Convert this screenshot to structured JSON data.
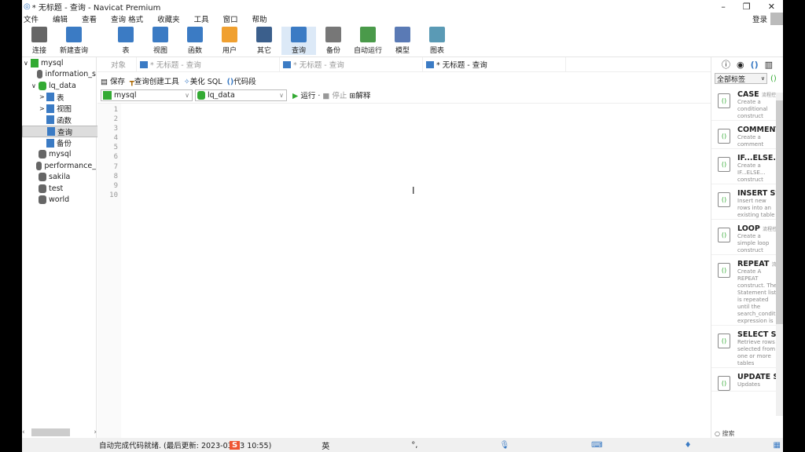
{
  "window": {
    "title": "* 无标题 - 查询 - Navicat Premium",
    "minimize": "–",
    "maximize": "❐",
    "close": "✕"
  },
  "menu": [
    "文件",
    "编辑",
    "查看",
    "查询 格式",
    "收藏夹",
    "工具",
    "窗口",
    "帮助"
  ],
  "login": "登录",
  "toolbar": [
    {
      "label": "连接",
      "color": "#666"
    },
    {
      "label": "新建查询",
      "color": "#3b7bc4"
    },
    {
      "label": "表",
      "color": "#3b7bc4"
    },
    {
      "label": "视图",
      "color": "#3b7bc4"
    },
    {
      "label": "函数",
      "color": "#3b7bc4"
    },
    {
      "label": "用户",
      "color": "#f0a030"
    },
    {
      "label": "其它",
      "color": "#3b5f8c"
    },
    {
      "label": "查询",
      "color": "#3b7bc4"
    },
    {
      "label": "备份",
      "color": "#777"
    },
    {
      "label": "自动运行",
      "color": "#4a9a4a"
    },
    {
      "label": "模型",
      "color": "#5a7ab5"
    },
    {
      "label": "图表",
      "color": "#5a9ab5"
    }
  ],
  "tree": [
    {
      "label": "mysql",
      "level": 0,
      "exp": "∨"
    },
    {
      "label": "information_s",
      "level": 1
    },
    {
      "label": "lq_data",
      "level": 1,
      "exp": "∨"
    },
    {
      "label": "表",
      "level": 2,
      "exp": ">"
    },
    {
      "label": "视图",
      "level": 2,
      "exp": ">"
    },
    {
      "label": "函数",
      "level": 2,
      "prefix": "fx"
    },
    {
      "label": "查询",
      "level": 2,
      "selected": true
    },
    {
      "label": "备份",
      "level": 2
    },
    {
      "label": "mysql",
      "level": 1
    },
    {
      "label": "performance_",
      "level": 1
    },
    {
      "label": "sakila",
      "level": 1
    },
    {
      "label": "test",
      "level": 1
    },
    {
      "label": "world",
      "level": 1
    }
  ],
  "tabs": {
    "objects": "对象",
    "items": [
      "* 无标题 - 查询",
      "* 无标题 - 查询",
      "* 无标题 - 查询"
    ]
  },
  "editor_toolbar": {
    "save": "保存",
    "builder": "查询创建工具",
    "beautify": "美化 SQL",
    "snippet": "代码段",
    "run": "运行 ·",
    "stop": "停止",
    "explain": "解释"
  },
  "connection": "mysql",
  "database": "lq_data",
  "line_numbers": [
    "1",
    "2",
    "3",
    "4",
    "5",
    "6",
    "7",
    "8",
    "9",
    "10"
  ],
  "right_panel": {
    "filter": "全部标签",
    "snippets": [
      {
        "name": "CASE",
        "tag": "流程控",
        "desc": "Create a conditional construct"
      },
      {
        "name": "COMMENT",
        "tag": "",
        "desc": "Create a comment"
      },
      {
        "name": "IF...ELSE...",
        "tag": "",
        "desc": "Create a IF...ELSE... construct"
      },
      {
        "name": "INSERT Sy",
        "tag": "",
        "desc": "Insert new rows into an existing table"
      },
      {
        "name": "LOOP",
        "tag": "流程控",
        "desc": "Create a simple loop construct"
      },
      {
        "name": "REPEAT",
        "tag": "流",
        "desc": "Create A REPEAT construct. The Statement list is repeated until the search_conditio expression is"
      },
      {
        "name": "SELECT Sy",
        "tag": "",
        "desc": "Retrieve rows selected from one or more tables"
      },
      {
        "name": "UPDATE S",
        "tag": "",
        "desc": "Updates"
      }
    ],
    "search": "搜索"
  },
  "status": "自动完成代码就绪. (最后更新: 2023-03-13 10:55)",
  "ime": {
    "lang": "英",
    "punct": "°,"
  }
}
